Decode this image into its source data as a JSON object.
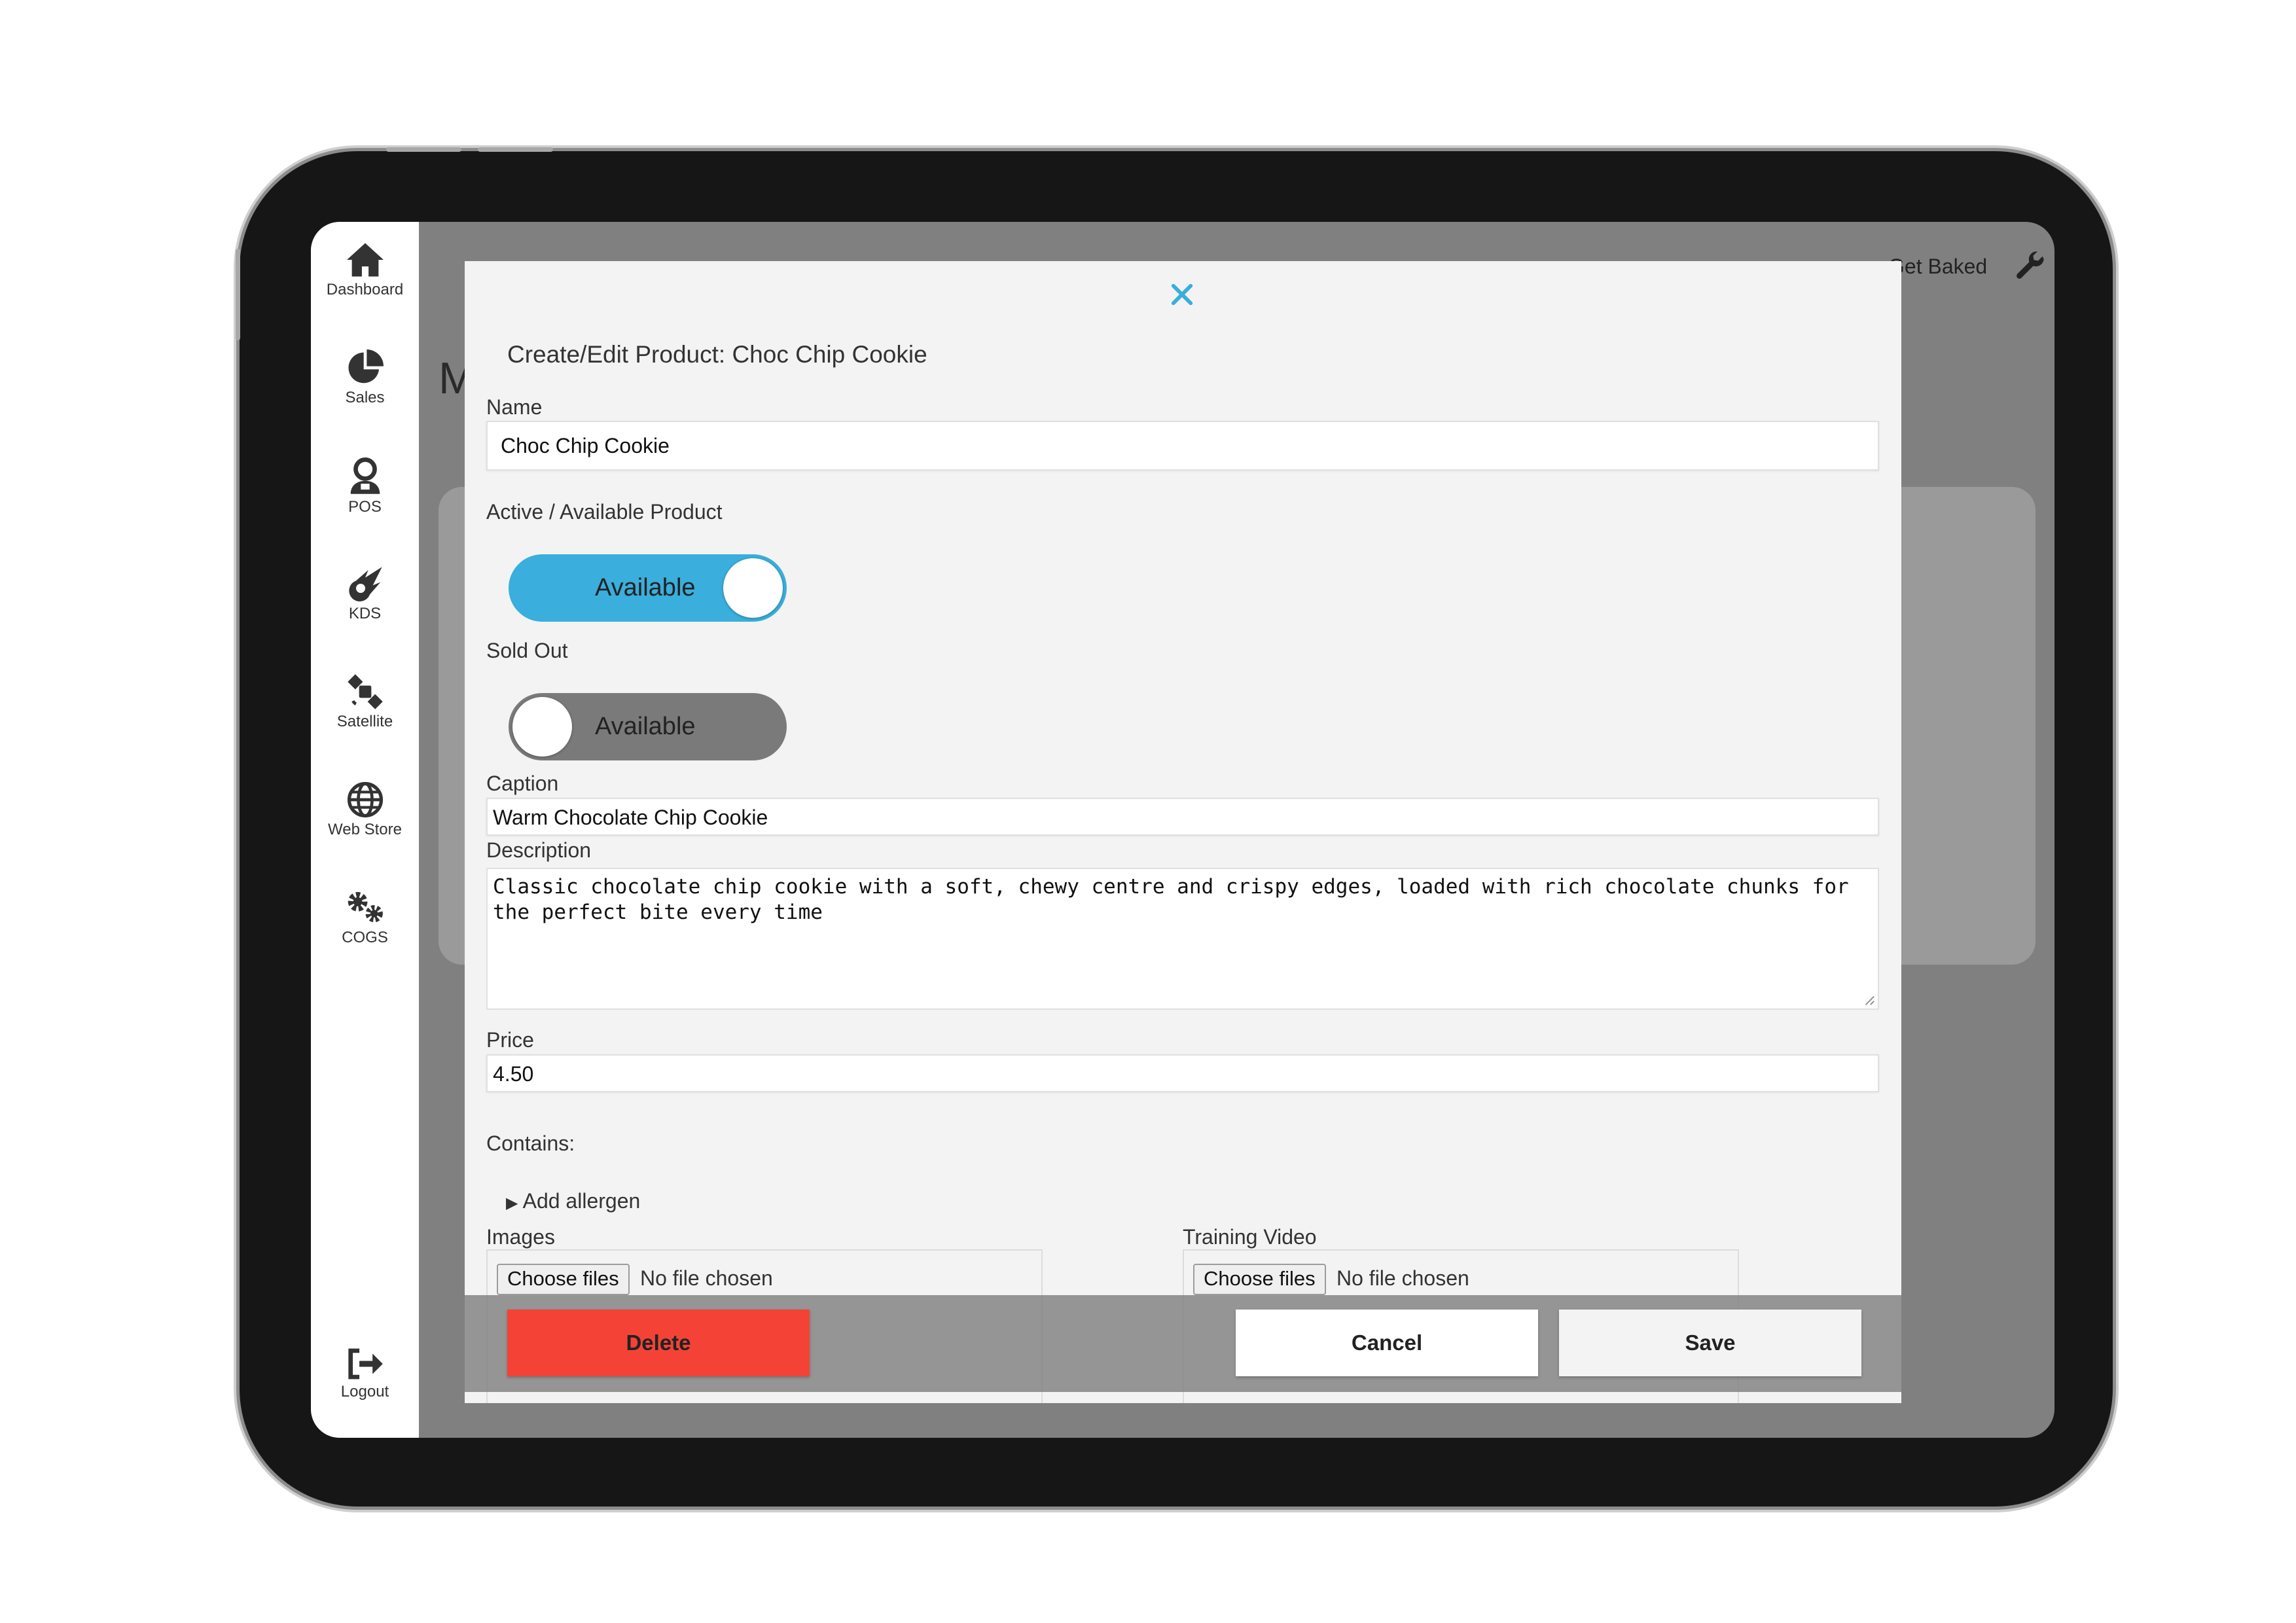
{
  "sidebar": {
    "items": [
      {
        "label": "Dashboard",
        "icon": "home-icon"
      },
      {
        "label": "Sales",
        "icon": "pie-chart-icon"
      },
      {
        "label": "POS",
        "icon": "user-icon"
      },
      {
        "label": "KDS",
        "icon": "meteor-icon"
      },
      {
        "label": "Satellite",
        "icon": "satellite-icon"
      },
      {
        "label": "Web Store",
        "icon": "globe-icon"
      },
      {
        "label": "COGS",
        "icon": "cogs-icon"
      }
    ],
    "logout": {
      "label": "Logout",
      "icon": "logout-icon"
    }
  },
  "header": {
    "store_name": "Get Baked"
  },
  "background": {
    "title_fragment": "M"
  },
  "modal": {
    "title": "Create/Edit Product: Choc Chip Cookie",
    "name_label": "Name",
    "name_value": "Choc Chip Cookie",
    "active_label": "Active / Available Product",
    "active_toggle": {
      "text": "Available",
      "on": true
    },
    "soldout_label": "Sold Out",
    "soldout_toggle": {
      "text": "Available",
      "on": false
    },
    "caption_label": "Caption",
    "caption_value": "Warm Chocolate Chip Cookie",
    "description_label": "Description",
    "description_value": "Classic chocolate chip cookie with a soft, chewy centre and crispy edges, loaded with rich chocolate chunks for the perfect bite every time",
    "price_label": "Price",
    "price_value": "4.50",
    "contains_label": "Contains:",
    "add_allergen": "Add allergen",
    "images_label": "Images",
    "training_video_label": "Training Video",
    "choose_files": "Choose files",
    "no_file": "No file chosen",
    "delete_label": "Delete",
    "cancel_label": "Cancel",
    "save_label": "Save"
  },
  "colors": {
    "accent": "#3aaedc",
    "delete": "#f44336",
    "toggle_off": "#7a7a7a"
  }
}
